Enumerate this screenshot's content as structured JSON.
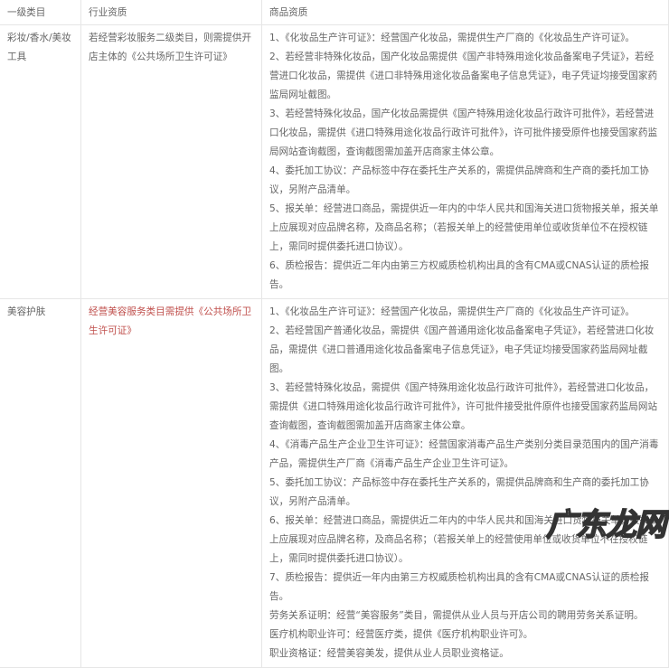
{
  "table": {
    "headers": [
      "一级类目",
      "行业资质",
      "商品资质"
    ],
    "rows": [
      {
        "category": "彩妆/香水/美妆工具",
        "industry": "若经营彩妆服务二级类目，则需提供开店主体的《公共场所卫生许可证》",
        "products": [
          "1、《化妆品生产许可证》：经营国产化妆品，需提供生产厂商的《化妆品生产许可证》。",
          "2、若经营非特殊化妆品，国产化妆品需提供《国产非特殊用途化妆品备案电子凭证》，若经营进口化妆品，需提供《进口非特殊用途化妆品备案电子信息凭证》，电子凭证均接受国家药监局网址截图。",
          "3、若经营特殊化妆品，国产化妆品需提供《国产特殊用途化妆品行政许可批件》，若经营进口化妆品，需提供《进口特殊用途化妆品行政许可批件》，许可批件接受原件也接受国家药监局网站查询截图，查询截图需加盖开店商家主体公章。",
          "4、委托加工协议：产品标签中存在委托生产关系的，需提供品牌商和生产商的委托加工协议，另附产品清单。",
          "5、报关单：经营进口商品，需提供近一年内的中华人民共和国海关进口货物报关单，报关单上应展现对应品牌名称，及商品名称；（若报关单上的经营使用单位或收货单位不在授权链上，需同时提供委托进口协议）。",
          "6、质检报告：提供近二年内由第三方权威质检机构出具的含有CMA或CNAS认证的质检报告。"
        ]
      },
      {
        "category": "美容护肤",
        "industry": "经营美容服务类目需提供《公共场所卫生许可证》",
        "products": [
          "1、《化妆品生产许可证》：经营国产化妆品，需提供生产厂商的《化妆品生产许可证》。",
          "2、若经营国产普通化妆品，需提供《国产普通用途化妆品备案电子凭证》，若经营进口化妆品，需提供《进口普通用途化妆品备案电子信息凭证》，电子凭证均接受国家药监局网址截图。",
          "3、若经营特殊化妆品，需提供《国产特殊用途化妆品行政许可批件》，若经营进口化妆品，需提供《进口特殊用途化妆品行政许可批件》，许可批件接受批件原件也接受国家药监局网站查询截图，查询截图需加盖开店商家主体公章。",
          "4、《消毒产品生产企业卫生许可证》：经营国家消毒产品生产类别分类目录范围内的国产消毒产品，需提供生产厂商《消毒产品生产企业卫生许可证》。",
          "5、委托加工协议：产品标签中存在委托生产关系的，需提供品牌商和生产商的委托加工协议，另附产品清单。",
          "6、报关单：经营进口商品，需提供近二年内的中华人民共和国海关进口货物报关单，报关单上应展现对应品牌名称，及商品名称；（若报关单上的经营使用单位或收货单位不在授权链上，需同时提供委托进口协议）。",
          "7、质检报告：提供近一年内由第三方权威质检机构出具的含有CMA或CNAS认证的质检报告。",
          "劳务关系证明：经营“美容服务”类目，需提供从业人员与开店公司的聘用劳务关系证明。",
          "医疗机构职业许可：经营医疗类，提供《医疗机构职业许可》。",
          "职业资格证：经营美容美发，提供从业人员职业资格证。"
        ]
      }
    ]
  },
  "watermark": "广东龙网",
  "colors": {
    "text": "#666666",
    "highlight": "#c0504d",
    "border": "#e6e6e6"
  }
}
